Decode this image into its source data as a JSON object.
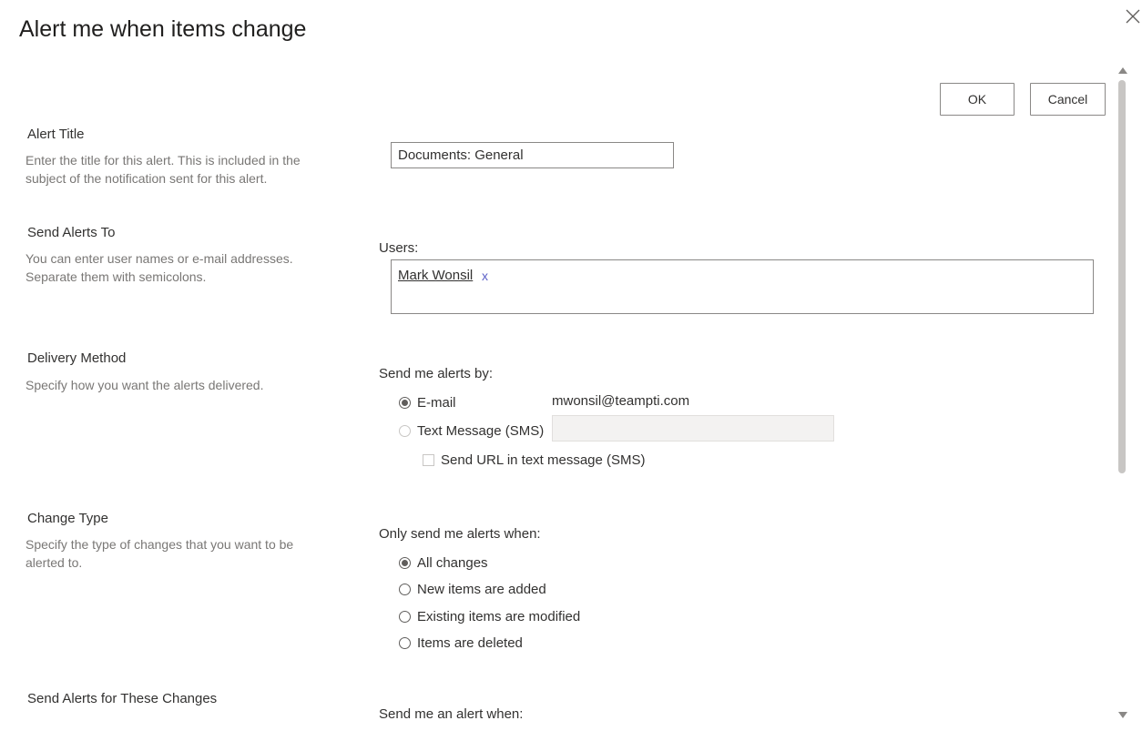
{
  "dialog": {
    "title": "Alert me when items change",
    "ok_label": "OK",
    "cancel_label": "Cancel"
  },
  "sections": {
    "alert_title": {
      "title": "Alert Title",
      "description": "Enter the title for this alert. This is included in the subject of the notification sent for this alert.",
      "value": "Documents: General"
    },
    "send_alerts_to": {
      "title": "Send Alerts To",
      "description": "You can enter user names or e-mail addresses. Separate them with semicolons.",
      "users_label": "Users:",
      "users": [
        {
          "name": "Mark Wonsil",
          "remove": "x"
        }
      ]
    },
    "delivery_method": {
      "title": "Delivery Method",
      "description": "Specify how you want the alerts delivered.",
      "prompt": "Send me alerts by:",
      "email_label": "E-mail",
      "email_value": "mwonsil@teampti.com",
      "sms_label": "Text Message (SMS)",
      "sms_value": "",
      "send_url_label": "Send URL in text message (SMS)",
      "selected": "E-mail"
    },
    "change_type": {
      "title": "Change Type",
      "description": "Specify the type of changes that you want to be alerted to.",
      "prompt": "Only send me alerts when:",
      "options": [
        "All changes",
        "New items are added",
        "Existing items are modified",
        "Items are deleted"
      ],
      "selected": "All changes"
    },
    "send_alerts_for_changes": {
      "title": "Send Alerts for These Changes",
      "prompt": "Send me an alert when:"
    }
  },
  "icons": {
    "close": "close-icon"
  }
}
